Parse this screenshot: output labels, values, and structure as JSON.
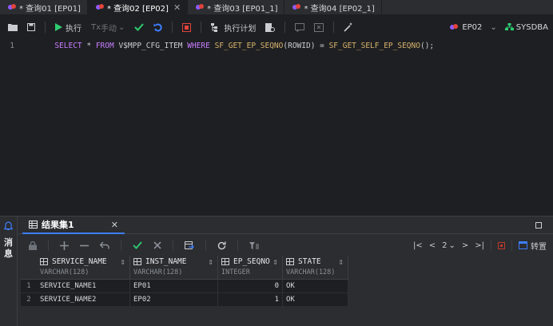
{
  "tabs": [
    {
      "label": "* 查询01 [EP01]",
      "active": false
    },
    {
      "label": "* 查询02 [EP02]",
      "active": true
    },
    {
      "label": "* 查询03 [EP01_1]",
      "active": false
    },
    {
      "label": "* 查询04 [EP02_1]",
      "active": false
    }
  ],
  "toolbar": {
    "execute_label": "执行",
    "commit_mode_label": "手动",
    "explain_label": "执行计划",
    "instance": "EP02",
    "user": "SYSDBA"
  },
  "editor": {
    "line_number": "1",
    "sql_parts": [
      {
        "t": "kw",
        "v": "SELECT"
      },
      {
        "t": "id",
        "v": " * "
      },
      {
        "t": "kw",
        "v": "FROM"
      },
      {
        "t": "id",
        "v": " V$MPP_CFG_ITEM "
      },
      {
        "t": "kw",
        "v": "WHERE"
      },
      {
        "t": "id",
        "v": " "
      },
      {
        "t": "fn",
        "v": "SF_GET_EP_SEQNO"
      },
      {
        "t": "id",
        "v": "(ROWID) = "
      },
      {
        "t": "fn",
        "v": "SF_GET_SELF_EP_SEQNO"
      },
      {
        "t": "id",
        "v": "();"
      }
    ]
  },
  "side": {
    "messages_label": "消息"
  },
  "result": {
    "tab_label": "结果集1",
    "page": "2",
    "convert_label": "转置",
    "columns": [
      {
        "name": "SERVICE_NAME",
        "type": "VARCHAR(128)"
      },
      {
        "name": "INST_NAME",
        "type": "VARCHAR(128)"
      },
      {
        "name": "EP_SEQNO",
        "type": "INTEGER"
      },
      {
        "name": "STATE",
        "type": "VARCHAR(128)"
      }
    ],
    "rows": [
      {
        "rn": "1",
        "cells": [
          "SERVICE_NAME1",
          "EP01",
          "0",
          "OK"
        ]
      },
      {
        "rn": "2",
        "cells": [
          "SERVICE_NAME2",
          "EP02",
          "1",
          "OK"
        ]
      }
    ]
  },
  "colors": {
    "accent": "#3d7eff",
    "run": "#2ecc71",
    "stop": "#e2433c",
    "keyword": "#c77dff",
    "function": "#d6b36b"
  }
}
